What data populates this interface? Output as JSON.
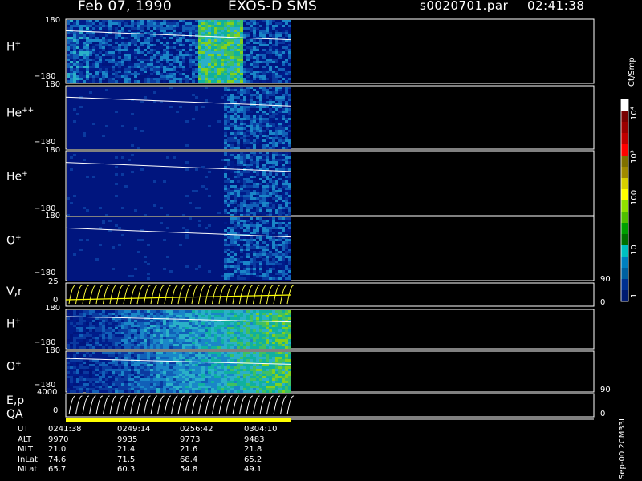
{
  "header": {
    "date": "Feb 07, 1990",
    "instrument": "EXOS-D SMS",
    "file": "s0020701.par",
    "time": "02:41:38"
  },
  "panels": [
    {
      "id": "hplus1",
      "species": "H",
      "charge": "+",
      "ytop": "180",
      "ybot": "−180"
    },
    {
      "id": "heplusplus",
      "species": "He",
      "charge": "++",
      "ytop": "180",
      "ybot": "−180"
    },
    {
      "id": "heplus",
      "species": "He",
      "charge": "+",
      "ytop": "180",
      "ybot": "−180"
    },
    {
      "id": "oplus1",
      "species": "O",
      "charge": "+",
      "ytop": "180",
      "ybot": "−180"
    },
    {
      "id": "vr",
      "species": "V,r",
      "charge": "",
      "ytop": "25",
      "ybot": "0",
      "right_top": "90",
      "right_bot": "0"
    },
    {
      "id": "hplus2",
      "species": "H",
      "charge": "+",
      "ytop": "180",
      "ybot": "−180"
    },
    {
      "id": "oplus2",
      "species": "O",
      "charge": "+",
      "ytop": "180",
      "ybot": "−180"
    },
    {
      "id": "ep",
      "species": "E,p",
      "charge": "",
      "ytop": "4000",
      "ybot": "0",
      "right_top": "90",
      "right_bot": "0"
    }
  ],
  "qa_label": "QA",
  "colorbar": {
    "unit": "Ct/Smp",
    "ticks": [
      "10⁴",
      "10³",
      "100",
      "10",
      "1"
    ],
    "colors": [
      "#ffffff",
      "#7a0000",
      "#9a0000",
      "#c00000",
      "#ff0000",
      "#807000",
      "#a08a00",
      "#d8d000",
      "#ffff00",
      "#90e000",
      "#50c000",
      "#00a000",
      "#007000",
      "#00c0c0",
      "#0080c0",
      "#0060a0",
      "#003090",
      "#001a70"
    ]
  },
  "footer": {
    "row_labels": [
      "UT",
      "ALT",
      "MLT",
      "InLat",
      "MLat"
    ],
    "columns": [
      [
        "0241:38",
        "9970",
        "21.0",
        "74.6",
        "65.7"
      ],
      [
        "0249:14",
        "9935",
        "21.4",
        "71.5",
        "60.3"
      ],
      [
        "0256:42",
        "9773",
        "21.6",
        "68.4",
        "54.8"
      ],
      [
        "0304:10",
        "9483",
        "21.8",
        "65.2",
        "49.1"
      ]
    ]
  },
  "side_caption": "Sep-00 2CM33L",
  "chart_data": {
    "type": "heatmap",
    "title": "Feb 07, 1990   EXOS-D SMS",
    "x_tick_labels": [
      "0241:38",
      "0249:14",
      "0256:42",
      "0304:10"
    ],
    "panels": [
      "H+",
      "He++",
      "He+",
      "O+",
      "V,r",
      "H+",
      "O+",
      "E,p"
    ],
    "colorbar_label": "Ct/Smp",
    "colorbar_ticks": [
      "1",
      "10",
      "100",
      "10^3",
      "10^4"
    ],
    "colorbar_scale": "log"
  }
}
